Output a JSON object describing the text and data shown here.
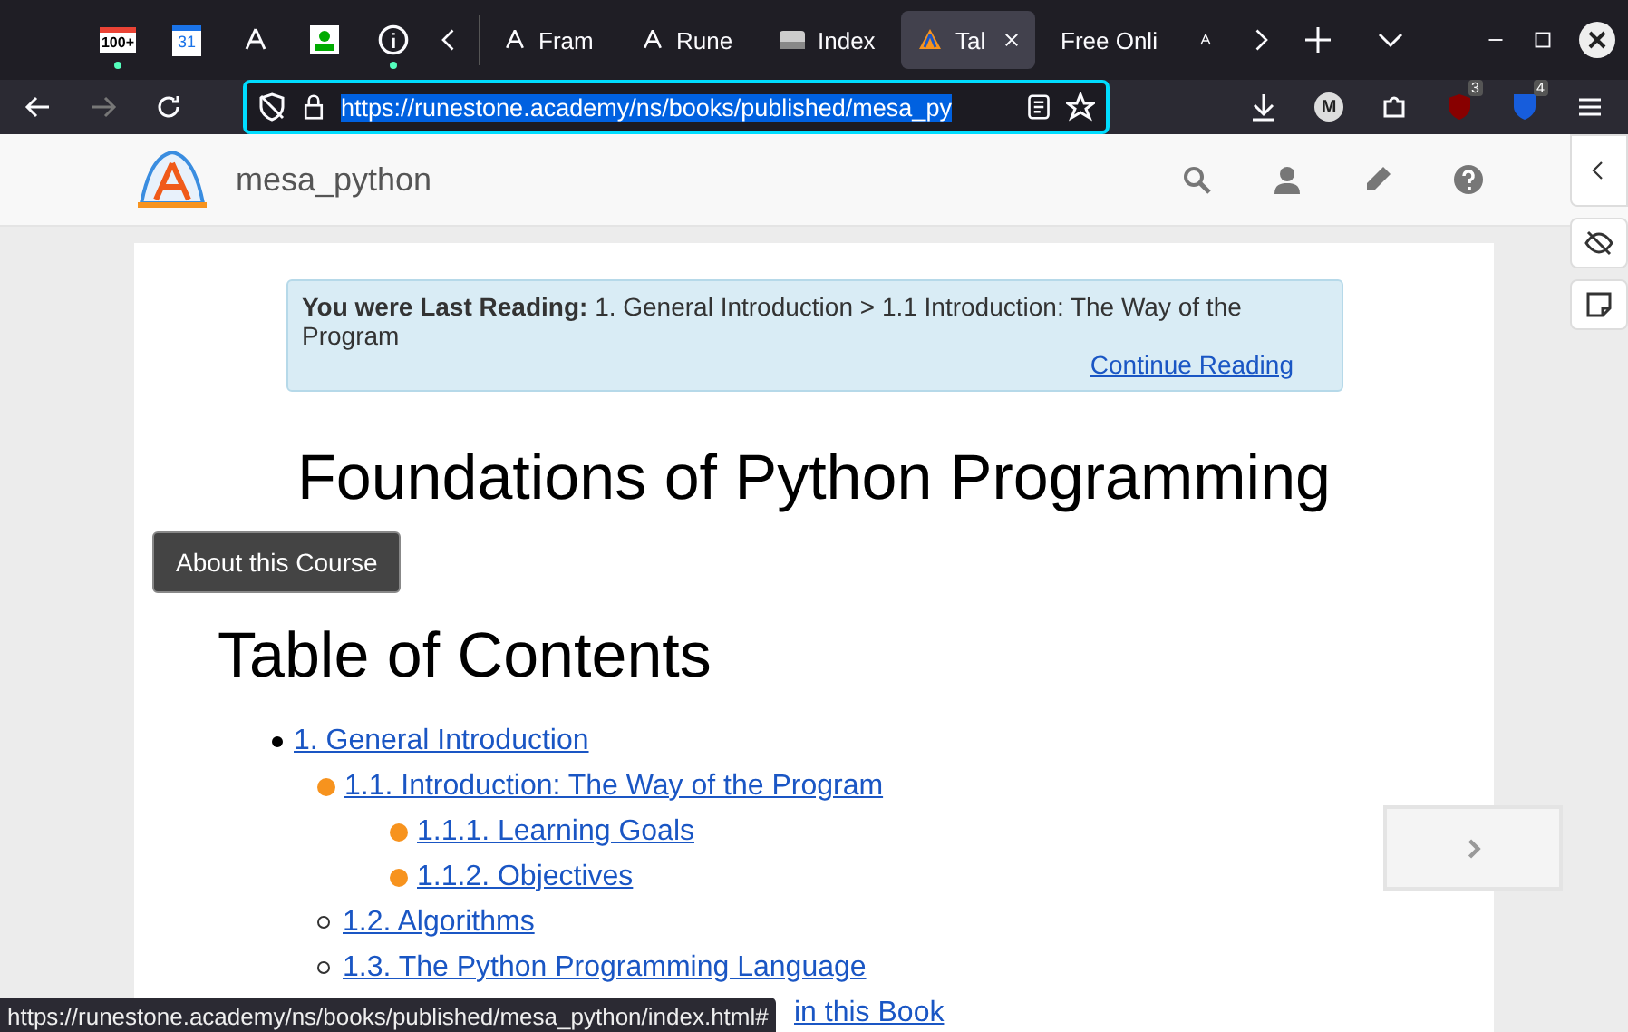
{
  "pinned_tabs": [
    {
      "kind": "mail",
      "badge": "100+",
      "attention": true
    },
    {
      "kind": "calendar",
      "badge": "31",
      "attention": false
    },
    {
      "kind": "runestone",
      "attention": false
    },
    {
      "kind": "person",
      "attention": false
    },
    {
      "kind": "info",
      "attention": true
    }
  ],
  "tabs": [
    {
      "kind": "runestone",
      "label": "Fram",
      "selected": false
    },
    {
      "kind": "runestone",
      "label": "Rune",
      "selected": false
    },
    {
      "kind": "drive",
      "label": "Index",
      "selected": false
    },
    {
      "kind": "logo",
      "label": "Tal",
      "selected": true
    },
    {
      "kind": "none",
      "label": "Free Onli",
      "selected": false
    },
    {
      "kind": "runestone",
      "selected": false
    }
  ],
  "address_bar": {
    "url": "https://runestone.academy/ns/books/published/mesa_py"
  },
  "extensions": [
    {
      "kind": "account",
      "text": "M"
    },
    {
      "kind": "ublock",
      "text": "3"
    },
    {
      "kind": "bitwarden",
      "text": "4"
    }
  ],
  "site_header": {
    "title": "mesa_python"
  },
  "last_reading": {
    "label": "You were Last Reading:",
    "path": "1. General Introduction > 1.1 Introduction: The Way of the Program",
    "link": "Continue Reading"
  },
  "title": "Foundations of Python Programming",
  "about_button": "About this Course",
  "toc": {
    "heading": "Table of Contents",
    "items": [
      {
        "label": "1. General Introduction",
        "children": [
          {
            "label": "1.1. Introduction: The Way of the Program",
            "visited": true,
            "children": [
              {
                "label": "1.1.1. Learning Goals",
                "visited": true
              },
              {
                "label": "1.1.2. Objectives",
                "visited": true
              }
            ]
          },
          {
            "label": "1.2. Algorithms",
            "visited": false
          },
          {
            "label": "1.3. The Python Programming Language",
            "visited": false
          },
          {
            "label": "in this Book",
            "kind": "partial"
          }
        ]
      }
    ]
  },
  "status_url": "https://runestone.academy/ns/books/published/mesa_python/index.html#"
}
